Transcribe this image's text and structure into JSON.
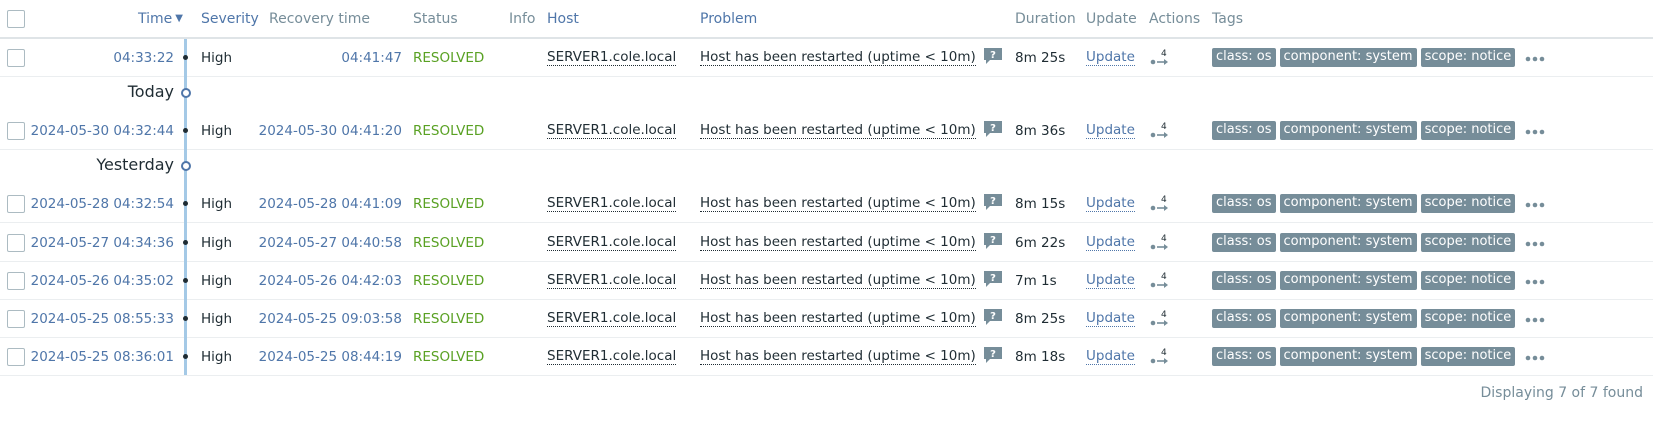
{
  "header": {
    "time": "Time",
    "sort_arrow": "▼",
    "severity": "Severity",
    "recovery_time": "Recovery time",
    "status": "Status",
    "info": "Info",
    "host": "Host",
    "problem": "Problem",
    "duration": "Duration",
    "update": "Update",
    "actions": "Actions",
    "tags": "Tags"
  },
  "dividers": {
    "today": "Today",
    "yesterday": "Yesterday"
  },
  "rows": [
    {
      "time": "04:33:22",
      "severity": "High",
      "recovery": "04:41:47",
      "status": "RESOLVED",
      "host": "SERVER1.cole.local",
      "problem": "Host has been restarted (uptime < 10m)",
      "duration": "8m 25s",
      "update": "Update",
      "actions_count": "4",
      "tags": [
        "class: os",
        "component: system",
        "scope: notice"
      ]
    },
    {
      "time": "2024-05-30 04:32:44",
      "severity": "High",
      "recovery": "2024-05-30 04:41:20",
      "status": "RESOLVED",
      "host": "SERVER1.cole.local",
      "problem": "Host has been restarted (uptime < 10m)",
      "duration": "8m 36s",
      "update": "Update",
      "actions_count": "4",
      "tags": [
        "class: os",
        "component: system",
        "scope: notice"
      ]
    },
    {
      "time": "2024-05-28 04:32:54",
      "severity": "High",
      "recovery": "2024-05-28 04:41:09",
      "status": "RESOLVED",
      "host": "SERVER1.cole.local",
      "problem": "Host has been restarted (uptime < 10m)",
      "duration": "8m 15s",
      "update": "Update",
      "actions_count": "4",
      "tags": [
        "class: os",
        "component: system",
        "scope: notice"
      ]
    },
    {
      "time": "2024-05-27 04:34:36",
      "severity": "High",
      "recovery": "2024-05-27 04:40:58",
      "status": "RESOLVED",
      "host": "SERVER1.cole.local",
      "problem": "Host has been restarted (uptime < 10m)",
      "duration": "6m 22s",
      "update": "Update",
      "actions_count": "4",
      "tags": [
        "class: os",
        "component: system",
        "scope: notice"
      ]
    },
    {
      "time": "2024-05-26 04:35:02",
      "severity": "High",
      "recovery": "2024-05-26 04:42:03",
      "status": "RESOLVED",
      "host": "SERVER1.cole.local",
      "problem": "Host has been restarted (uptime < 10m)",
      "duration": "7m 1s",
      "update": "Update",
      "actions_count": "4",
      "tags": [
        "class: os",
        "component: system",
        "scope: notice"
      ]
    },
    {
      "time": "2024-05-25 08:55:33",
      "severity": "High",
      "recovery": "2024-05-25 09:03:58",
      "status": "RESOLVED",
      "host": "SERVER1.cole.local",
      "problem": "Host has been restarted (uptime < 10m)",
      "duration": "8m 25s",
      "update": "Update",
      "actions_count": "4",
      "tags": [
        "class: os",
        "component: system",
        "scope: notice"
      ]
    },
    {
      "time": "2024-05-25 08:36:01",
      "severity": "High",
      "recovery": "2024-05-25 08:44:19",
      "status": "RESOLVED",
      "host": "SERVER1.cole.local",
      "problem": "Host has been restarted (uptime < 10m)",
      "duration": "8m 18s",
      "update": "Update",
      "actions_count": "4",
      "tags": [
        "class: os",
        "component: system",
        "scope: notice"
      ]
    }
  ],
  "footer": {
    "text": "Displaying 7 of 7 found"
  },
  "colors": {
    "link": "#4f76a9",
    "resolved": "#59a123",
    "tag_bg": "#768d99",
    "timeline": "#a4c9e6"
  },
  "icons": {
    "hint": "message-question-icon",
    "actions": "actions-arrow-icon",
    "more": "more-dots-icon",
    "sort": "sort-desc-icon"
  }
}
